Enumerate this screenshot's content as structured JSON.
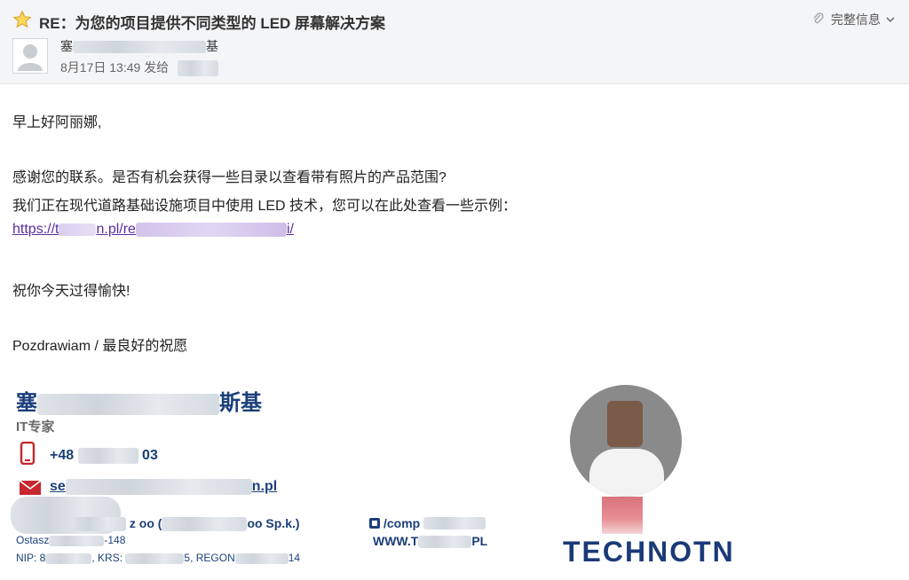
{
  "email": {
    "subject": "RE：为您的项目提供不同类型的 LED 屏幕解决方案",
    "full_info_label": "完整信息",
    "sender_name": "塞",
    "sender_name_tail": "基",
    "date_time": "8月17日 13:49",
    "sent_to_label": "发给",
    "body": {
      "greeting": "早上好阿丽娜,",
      "p1": "感谢您的联系。是否有机会获得一些目录以查看带有照片的产品范围?",
      "p2": "我们正在现代道路基础设施项目中使用 LED 技术，您可以在此处查看一些示例：",
      "link_start": "https://t",
      "link_mid": "n.pl/re",
      "link_end": "i/",
      "wish": "祝你今天过得愉快!",
      "closing": "Pozdrawiam / 最良好的祝愿"
    },
    "signature": {
      "name_start": "塞",
      "name_end": "斯基",
      "title": "IT专家",
      "phone_start": "+48",
      "phone_end": "03",
      "email_start": "se",
      "email_end": "n.pl",
      "company_mid": "z oo  (",
      "company_end": "oo Sp.k.)",
      "address_start": "Ostasz",
      "address_mid": "-148",
      "nip_start": "NIP: 8",
      "krs_label": "KRS:",
      "regon_label": "5, REGON",
      "regon_end": "14",
      "company_link": "/comp",
      "www_start": "WWW.T",
      "www_end": "PL",
      "logo_text": "TECHNOTN"
    }
  }
}
